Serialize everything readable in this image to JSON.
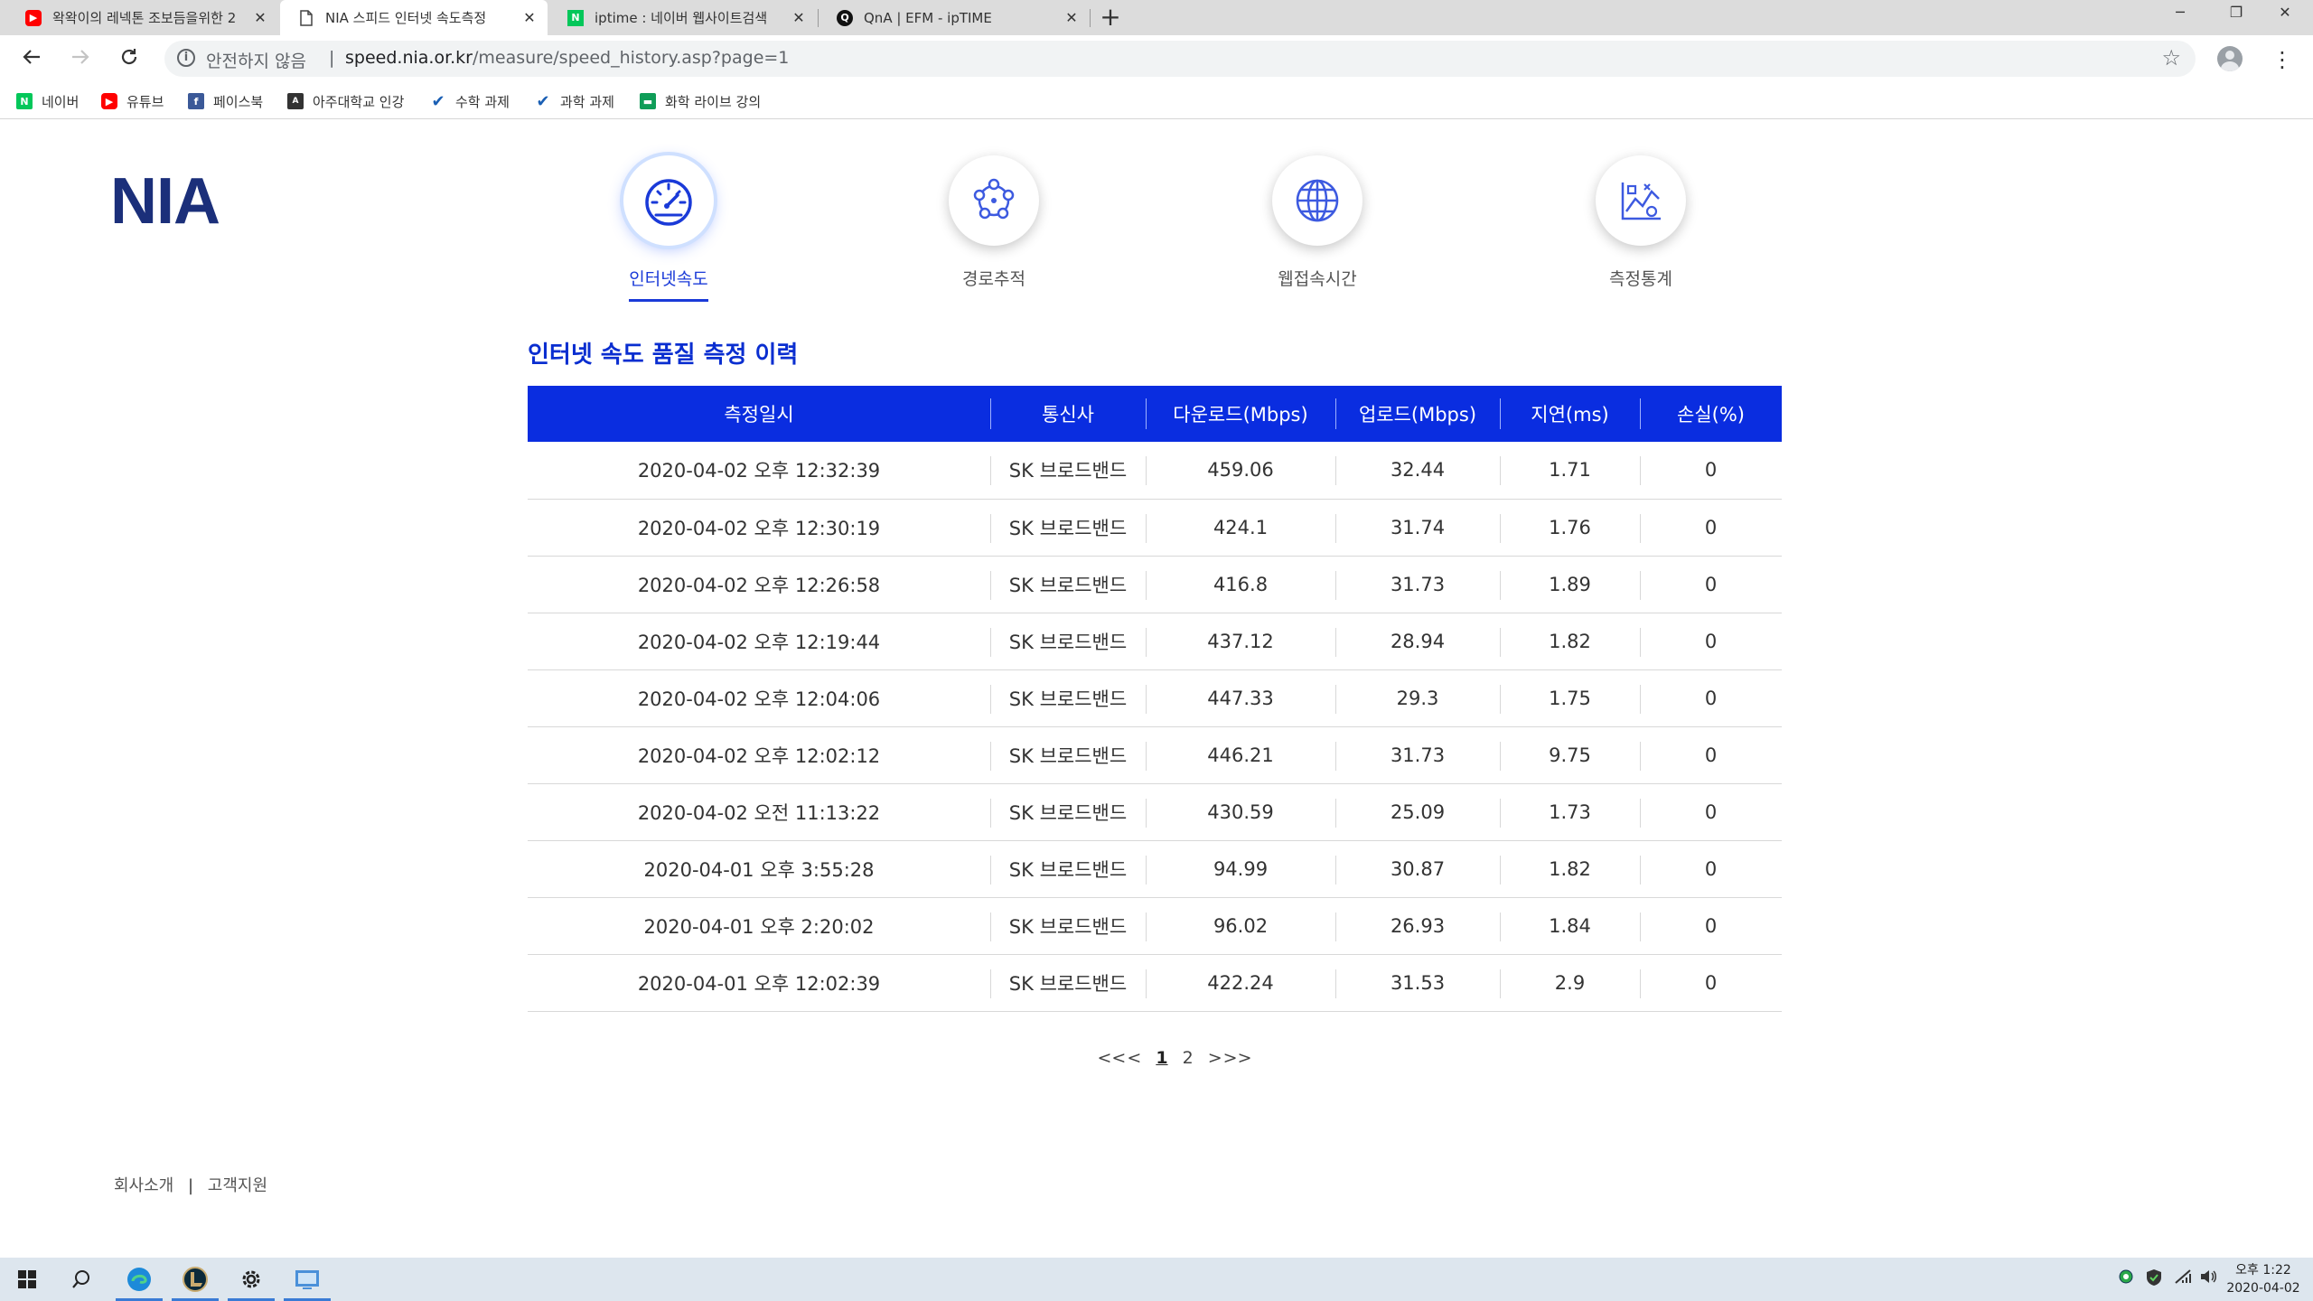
{
  "browser": {
    "tabs": [
      {
        "title": "왁왁이의 레넥톤 조보듬을위한 2",
        "favicon": "youtube-icon",
        "active": false
      },
      {
        "title": "NIA 스피드 인터넷 속도측정",
        "favicon": "document-icon",
        "active": true
      },
      {
        "title": "iptime : 네이버 웹사이트검색",
        "favicon": "naver-icon",
        "active": false
      },
      {
        "title": "QnA | EFM - ipTIME",
        "favicon": "iptime-icon",
        "active": false
      }
    ],
    "close_glyph": "✕",
    "new_tab_glyph": "+",
    "address": {
      "security_label": "안전하지 않음",
      "separator": "|",
      "domain": "speed.nia.or.kr",
      "path": "/measure/speed_history.asp?page=1"
    },
    "bookmarks": [
      {
        "label": "네이버",
        "icon": "naver-icon"
      },
      {
        "label": "유튜브",
        "icon": "youtube-icon"
      },
      {
        "label": "페이스북",
        "icon": "facebook-icon"
      },
      {
        "label": "아주대학교 인강",
        "icon": "ajou-icon"
      },
      {
        "label": "수학 과제",
        "icon": "check-icon"
      },
      {
        "label": "과학 과제",
        "icon": "check-icon"
      },
      {
        "label": "화학 라이브 강의",
        "icon": "classroom-icon"
      }
    ],
    "colors": {
      "tabstrip": "#dcdcdc",
      "youtube": "#ff0000",
      "naver": "#03c75a",
      "facebook": "#3b5998"
    }
  },
  "page": {
    "logo": "NIA",
    "nav": [
      {
        "label": "인터넷속도",
        "icon": "speedometer-icon",
        "active": true
      },
      {
        "label": "경로추적",
        "icon": "route-trace-icon",
        "active": false
      },
      {
        "label": "웹접속시간",
        "icon": "globe-icon",
        "active": false
      },
      {
        "label": "측정통계",
        "icon": "statistics-icon",
        "active": false
      }
    ],
    "section_title": "인터넷 속도 품질 측정 이력",
    "table": {
      "headers": [
        "측정일시",
        "통신사",
        "다운로드(Mbps)",
        "업로드(Mbps)",
        "지연(ms)",
        "손실(%)"
      ],
      "rows": [
        [
          "2020-04-02 오후 12:32:39",
          "SK 브로드밴드",
          "459.06",
          "32.44",
          "1.71",
          "0"
        ],
        [
          "2020-04-02 오후 12:30:19",
          "SK 브로드밴드",
          "424.1",
          "31.74",
          "1.76",
          "0"
        ],
        [
          "2020-04-02 오후 12:26:58",
          "SK 브로드밴드",
          "416.8",
          "31.73",
          "1.89",
          "0"
        ],
        [
          "2020-04-02 오후 12:19:44",
          "SK 브로드밴드",
          "437.12",
          "28.94",
          "1.82",
          "0"
        ],
        [
          "2020-04-02 오후 12:04:06",
          "SK 브로드밴드",
          "447.33",
          "29.3",
          "1.75",
          "0"
        ],
        [
          "2020-04-02 오후 12:02:12",
          "SK 브로드밴드",
          "446.21",
          "31.73",
          "9.75",
          "0"
        ],
        [
          "2020-04-02 오전 11:13:22",
          "SK 브로드밴드",
          "430.59",
          "25.09",
          "1.73",
          "0"
        ],
        [
          "2020-04-01 오후 3:55:28",
          "SK 브로드밴드",
          "94.99",
          "30.87",
          "1.82",
          "0"
        ],
        [
          "2020-04-01 오후 2:20:02",
          "SK 브로드밴드",
          "96.02",
          "26.93",
          "1.84",
          "0"
        ],
        [
          "2020-04-01 오후 12:02:39",
          "SK 브로드밴드",
          "422.24",
          "31.53",
          "2.9",
          "0"
        ]
      ]
    },
    "pager": {
      "first": "<<",
      "prev": "<",
      "pages": [
        "1",
        "2"
      ],
      "current": "1",
      "next": ">",
      "last": ">>"
    },
    "footer": {
      "about": "회사소개",
      "separator": "|",
      "support": "고객지원"
    },
    "colors": {
      "accent": "#0a2de0",
      "logo": "#1b2f7a",
      "title": "#0a2ed0"
    }
  },
  "taskbar": {
    "apps": [
      "windows-start-icon",
      "search-icon",
      "edge-icon",
      "league-of-legends-icon",
      "settings-icon",
      "remote-desktop-icon"
    ],
    "clock": {
      "time": "오후 1:22",
      "date": "2020-04-02"
    },
    "tray": [
      "network-globe-icon",
      "security-shield-icon",
      "wifi-icon",
      "volume-icon"
    ]
  }
}
